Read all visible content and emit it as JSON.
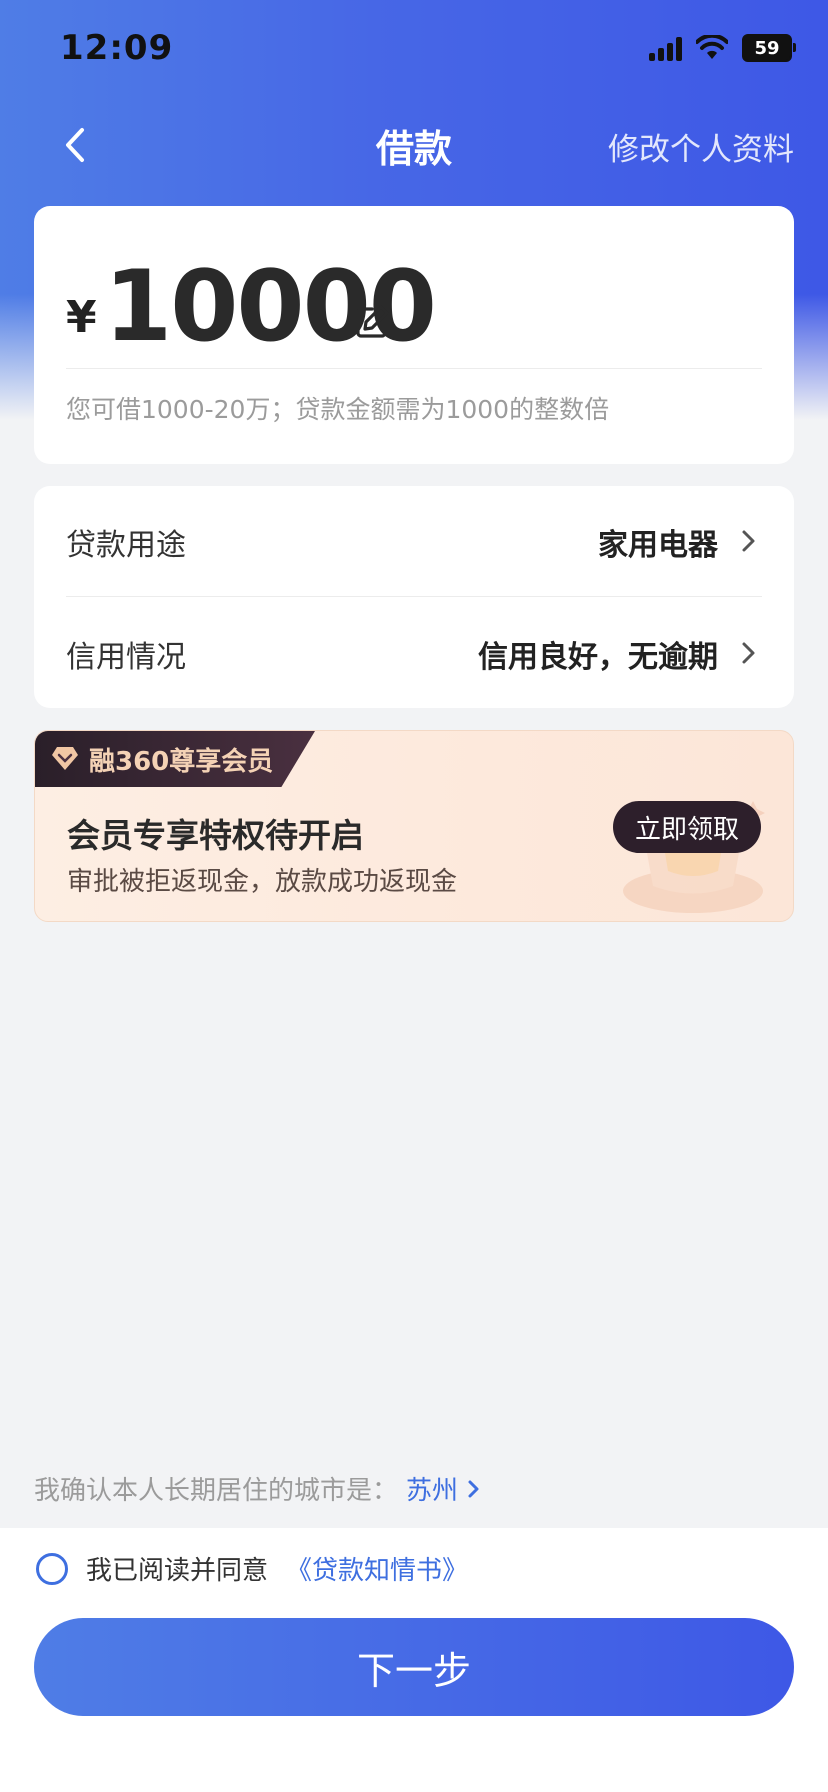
{
  "status": {
    "time": "12:09",
    "battery": "59"
  },
  "nav": {
    "title": "借款",
    "right_action": "修改个人资料"
  },
  "amount_card": {
    "currency": "¥",
    "amount": "10000",
    "hint": "您可借1000-20万；贷款金额需为1000的整数倍"
  },
  "info": {
    "rows": [
      {
        "label": "贷款用途",
        "value": "家用电器"
      },
      {
        "label": "信用情况",
        "value": "信用良好，无逾期"
      }
    ]
  },
  "promo": {
    "tag": "融360尊享会员",
    "title": "会员专享特权待开启",
    "subtitle": "审批被拒返现金，放款成功返现金",
    "button": "立即领取"
  },
  "city": {
    "label": "我确认本人长期居住的城市是：",
    "value": "苏州"
  },
  "agreement": {
    "text": "我已阅读并同意",
    "link": "《贷款知情书》"
  },
  "next_button": "下一步",
  "colors": {
    "primary": "#3e6fe0",
    "gradient_start": "#4f7de6",
    "gradient_end": "#3e58e6"
  }
}
